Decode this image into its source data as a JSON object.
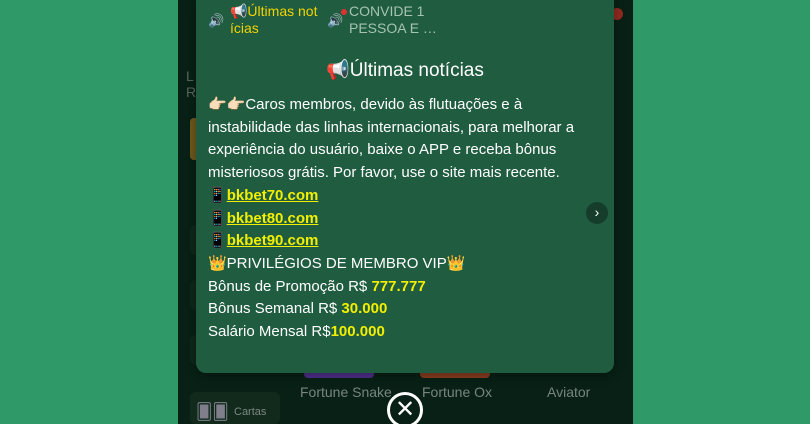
{
  "background": {
    "left_labels": [
      "L",
      "R"
    ],
    "sidebar_card_label": "Cartas",
    "games": [
      "Fortune Snake",
      "Fortune Ox",
      "Aviator"
    ]
  },
  "modal": {
    "tabs": [
      {
        "icon": "speaker-icon",
        "label_line1": "📢Últimas not",
        "label_line2": "ícias",
        "active": true
      },
      {
        "icon": "speaker-icon",
        "label_line1": "CONVIDE 1",
        "label_line2": "PESSOA E …",
        "active": false
      }
    ],
    "title": "📢Últimas notícias",
    "intro": "👉🏻👉🏻Caros membros, devido às flutuações e à instabilidade das linhas internacionais, para melhorar a experiência do usuário, baixe o APP e receba bônus misteriosos grátis. Por favor, use o site mais recente.",
    "links": [
      {
        "prefix": "📱",
        "text": "bkbet70.com"
      },
      {
        "prefix": "📱",
        "text": "bkbet80.com"
      },
      {
        "prefix": "📱",
        "text": "bkbet90.com"
      }
    ],
    "vip_heading": "👑PRIVILÉGIOS DE MEMBRO VIP👑",
    "bonuses": [
      {
        "label": "Bônus de Promoção R$ ",
        "value": "777.777"
      },
      {
        "label": "Bônus Semanal R$ ",
        "value": "30.000"
      },
      {
        "label": "Salário Mensal R$",
        "value": "100.000"
      }
    ],
    "next_symbol": "›",
    "close_symbol": "✕"
  },
  "colors": {
    "page_bg": "#2f9a68",
    "modal_bg": "#1f5c40",
    "accent_yellow": "#f2ef00",
    "tab_active": "#f2d300"
  }
}
